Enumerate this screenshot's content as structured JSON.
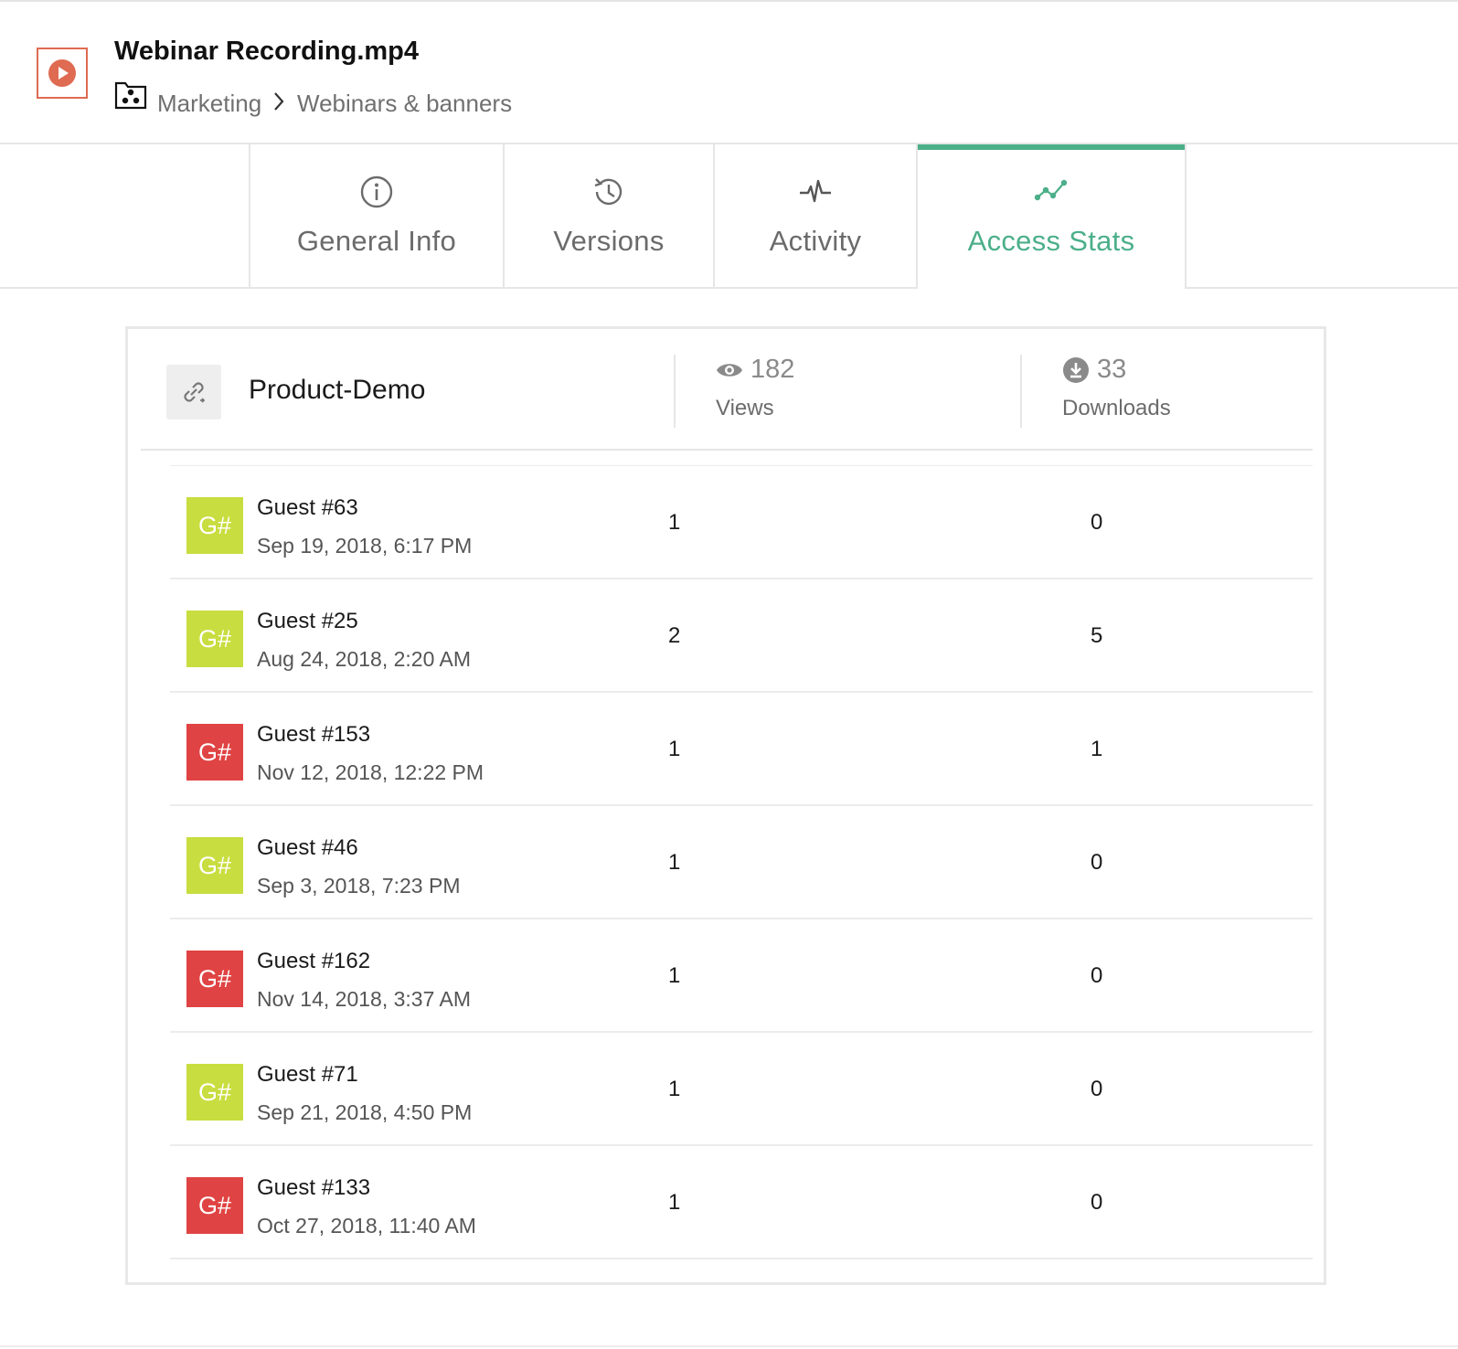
{
  "file": {
    "title": "Webinar Recording.mp4",
    "icon": "video-play-icon",
    "icon_color": "#df6b52"
  },
  "breadcrumb": {
    "folder_icon": "shared-folder-icon",
    "items": [
      "Marketing",
      "Webinars & banners"
    ]
  },
  "tabs": [
    {
      "label": "General Info",
      "icon": "info-icon",
      "active": false
    },
    {
      "label": "Versions",
      "icon": "history-icon",
      "active": false
    },
    {
      "label": "Activity",
      "icon": "pulse-icon",
      "active": false
    },
    {
      "label": "Access Stats",
      "icon": "stats-icon",
      "active": true
    }
  ],
  "colors": {
    "accent": "#4caf8a",
    "avatar_green": "#c8dd3f",
    "avatar_red": "#e04343"
  },
  "link": {
    "icon": "link-icon",
    "name": "Product-Demo",
    "views_count": "182",
    "views_label": "Views",
    "downloads_count": "33",
    "downloads_label": "Downloads"
  },
  "guests": [
    {
      "avatar": "G#",
      "color": "green",
      "name": "Guest #63",
      "date": "Sep 19, 2018, 6:17 PM",
      "views": "1",
      "downloads": "0"
    },
    {
      "avatar": "G#",
      "color": "green",
      "name": "Guest #25",
      "date": "Aug 24, 2018, 2:20 AM",
      "views": "2",
      "downloads": "5"
    },
    {
      "avatar": "G#",
      "color": "red",
      "name": "Guest #153",
      "date": "Nov 12, 2018, 12:22 PM",
      "views": "1",
      "downloads": "1"
    },
    {
      "avatar": "G#",
      "color": "green",
      "name": "Guest #46",
      "date": "Sep 3, 2018, 7:23 PM",
      "views": "1",
      "downloads": "0"
    },
    {
      "avatar": "G#",
      "color": "red",
      "name": "Guest #162",
      "date": "Nov 14, 2018, 3:37 AM",
      "views": "1",
      "downloads": "0"
    },
    {
      "avatar": "G#",
      "color": "green",
      "name": "Guest #71",
      "date": "Sep 21, 2018, 4:50 PM",
      "views": "1",
      "downloads": "0"
    },
    {
      "avatar": "G#",
      "color": "red",
      "name": "Guest #133",
      "date": "Oct 27, 2018, 11:40 AM",
      "views": "1",
      "downloads": "0"
    }
  ]
}
